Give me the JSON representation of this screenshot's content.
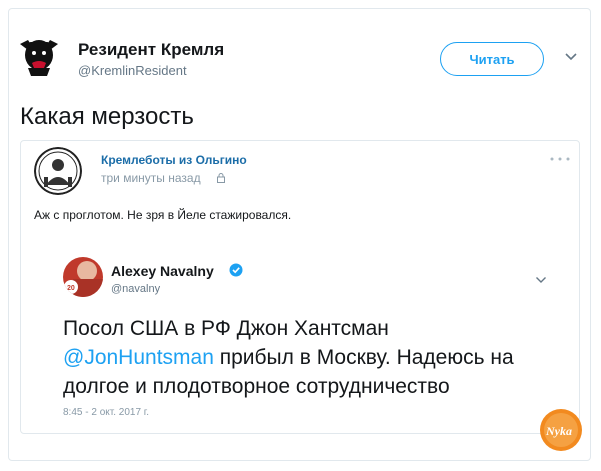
{
  "tweet": {
    "author_name": "Резидент Кремля",
    "author_handle": "@KremlinResident",
    "follow_label": "Читать",
    "text": "Какая мерзость"
  },
  "quoted": {
    "author_name": "Кремлеботы из Ольгино",
    "time": "три минуты назад",
    "text": "Аж с проглотом. Не зря в Йеле стажировался.",
    "embedded": {
      "author_name": "Alexey Navalny",
      "author_handle": "@navalny",
      "body_before": "Посол США в РФ Джон Хантсман",
      "mention": "@JonHuntsman",
      "body_after": " прибыл в Москву. Надеюсь на долгое и плодотворное сотрудничество",
      "date": "8:45 - 2 окт. 2017 г."
    }
  },
  "watermark": {
    "text": "Nyka"
  },
  "colors": {
    "accent": "#1da1f2",
    "quoted_name": "#1b6da8",
    "watermark": "#f28a1f"
  }
}
